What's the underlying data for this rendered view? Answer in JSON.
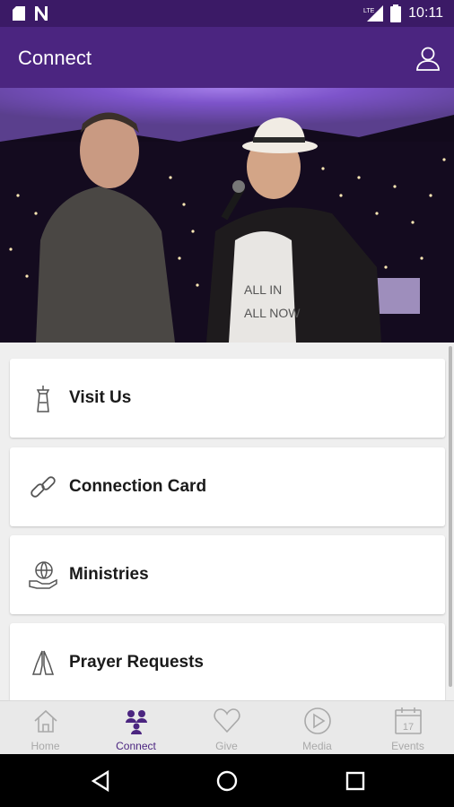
{
  "status_bar": {
    "time": "10:11",
    "network": "LTE",
    "icons": [
      "sd-card-icon",
      "n-icon",
      "signal-icon",
      "battery-icon"
    ]
  },
  "app_bar": {
    "title": "Connect",
    "profile_icon": "person-icon"
  },
  "hero": {
    "image_desc": "photo",
    "shirt_text": "ALL IN\nALL\nNOW"
  },
  "cards": [
    {
      "label": "Visit Us",
      "icon": "lighthouse-icon"
    },
    {
      "label": "Connection Card",
      "icon": "link-icon"
    },
    {
      "label": "Ministries",
      "icon": "globe-hand-icon"
    },
    {
      "label": "Prayer Requests",
      "icon": "praying-hands-icon"
    }
  ],
  "tabs": [
    {
      "label": "Home",
      "icon": "home-icon",
      "active": false
    },
    {
      "label": "Connect",
      "icon": "people-icon",
      "active": true
    },
    {
      "label": "Give",
      "icon": "heart-icon",
      "active": false
    },
    {
      "label": "Media",
      "icon": "play-icon",
      "active": false
    },
    {
      "label": "Events",
      "icon": "calendar-icon",
      "active": false,
      "calendar_day": "17"
    }
  ],
  "colors": {
    "app_bar": "#4b2580",
    "status_bar": "#3b1a66",
    "active_tab": "#4b2580",
    "inactive_tab": "#a9a9a9"
  }
}
